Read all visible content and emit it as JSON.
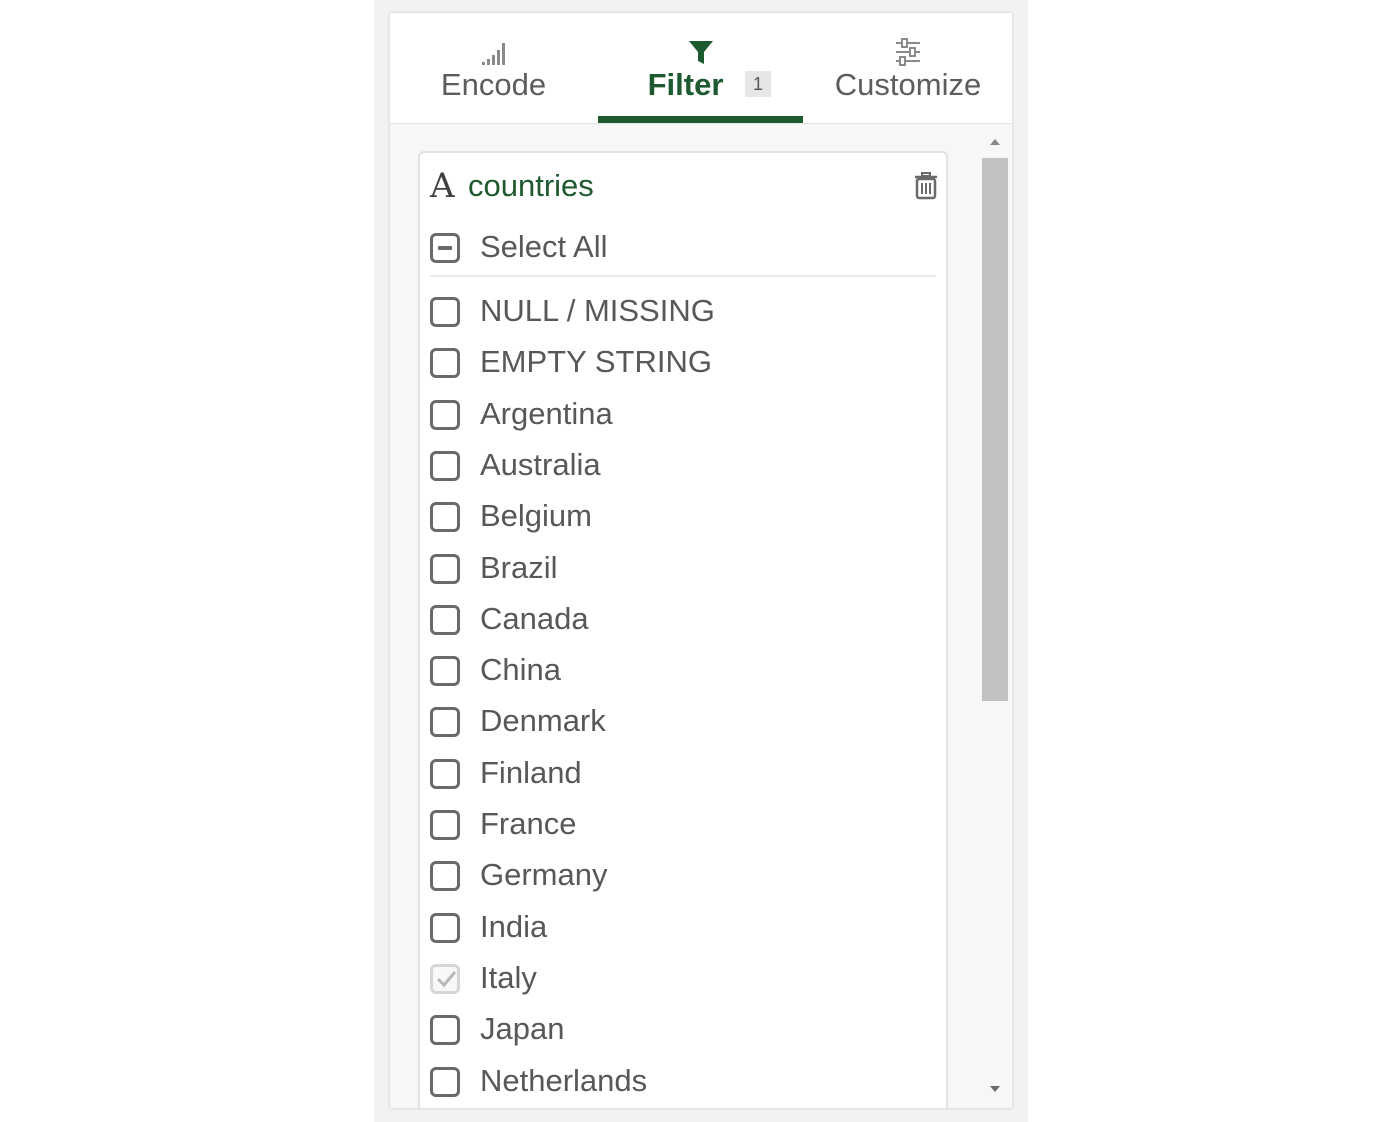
{
  "tabs": {
    "encode": {
      "label": "Encode",
      "icon": "bar-signal-icon"
    },
    "filter": {
      "label": "Filter",
      "badge": "1",
      "icon": "funnel-icon",
      "active": true
    },
    "customize": {
      "label": "Customize",
      "icon": "sliders-icon"
    }
  },
  "colors": {
    "accent": "#1e5a2f",
    "text": "#585858",
    "scroll_thumb": "#c1c1c1"
  },
  "filter_card": {
    "field_type_glyph": "A",
    "field_name": "countries",
    "delete_icon": "trash-icon",
    "select_all": {
      "label": "Select All",
      "state": "indeterminate"
    },
    "options": [
      {
        "label": "NULL / MISSING",
        "checked": false
      },
      {
        "label": "EMPTY STRING",
        "checked": false
      },
      {
        "label": "Argentina",
        "checked": false
      },
      {
        "label": "Australia",
        "checked": false
      },
      {
        "label": "Belgium",
        "checked": false
      },
      {
        "label": "Brazil",
        "checked": false
      },
      {
        "label": "Canada",
        "checked": false
      },
      {
        "label": "China",
        "checked": false
      },
      {
        "label": "Denmark",
        "checked": false
      },
      {
        "label": "Finland",
        "checked": false
      },
      {
        "label": "France",
        "checked": false
      },
      {
        "label": "Germany",
        "checked": false
      },
      {
        "label": "India",
        "checked": false
      },
      {
        "label": "Italy",
        "checked": true
      },
      {
        "label": "Japan",
        "checked": false
      },
      {
        "label": "Netherlands",
        "checked": false
      }
    ]
  }
}
